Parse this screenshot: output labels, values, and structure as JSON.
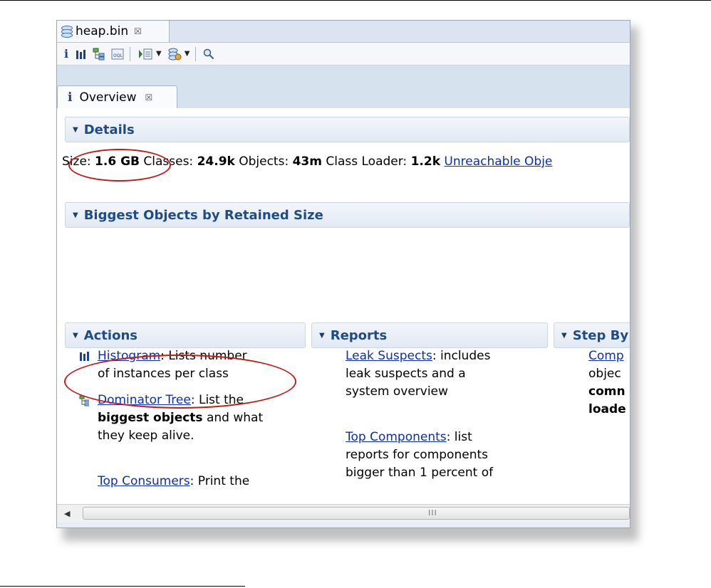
{
  "editor_tab": {
    "label": "heap.bin",
    "close": "☒"
  },
  "toolbar": {
    "icons": [
      "info-icon",
      "histogram-icon",
      "dominator-tree-icon",
      "oql-icon",
      "run-report-icon",
      "heap-dump-overview-icon",
      "search-icon"
    ]
  },
  "view_tab": {
    "icon": "i",
    "label": "Overview",
    "close": "☒"
  },
  "details": {
    "title": "Details",
    "size_label": "Size:",
    "size_value": "1.6 GB",
    "classes_label": "Classes:",
    "classes_value": "24.9k",
    "objects_label": "Objects:",
    "objects_value": "43m",
    "loader_label": "Class Loader:",
    "loader_value": "1.2k",
    "unreachable_link": "Unreachable Obje"
  },
  "biggest_objects": {
    "title": "Biggest Objects by Retained Size"
  },
  "actions": {
    "title": "Actions",
    "histogram_link": "Histogram",
    "histogram_text_1": ": Lists number",
    "histogram_text_2": "of instances per class",
    "dominator_link": "Dominator Tree",
    "dominator_text_1": ": List the",
    "dominator_bold": "biggest objects",
    "dominator_text_2": " and what",
    "dominator_text_3": "they keep alive.",
    "consumers_link": "Top Consumers",
    "consumers_text": ": Print the"
  },
  "reports": {
    "title": "Reports",
    "leak_link": "Leak Suspects",
    "leak_text_1": ": includes",
    "leak_text_2": "leak suspects and a",
    "leak_text_3": "system overview",
    "top_link": "Top Components",
    "top_text_1": ": list",
    "top_text_2": "reports for components",
    "top_text_3": "bigger than 1 percent of"
  },
  "step_by_step": {
    "title": "Step By",
    "line1_link": "Comp",
    "line2": "objec",
    "line3_bold": "comn",
    "line4_bold": "loade"
  },
  "scrollbar": {
    "grip": "III"
  },
  "colors": {
    "annotation": "#c01a1a",
    "link": "#0b2fb0",
    "section_title": "#1e4c84"
  }
}
